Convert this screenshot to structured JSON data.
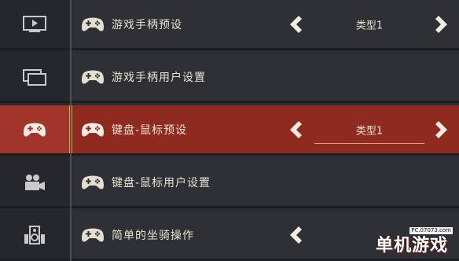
{
  "sidebar": {
    "icons": [
      "play-screen-icon",
      "windows-icon",
      "gamepad-icon",
      "video-camera-icon",
      "speaker-icon"
    ]
  },
  "rows": [
    {
      "label": "游戏手柄预设",
      "value": "类型1",
      "has_selector": true,
      "active": false
    },
    {
      "label": "游戏手柄用户设置",
      "has_selector": false,
      "active": false
    },
    {
      "label": "键盘-鼠标预设",
      "value": "类型1",
      "has_selector": true,
      "active": true
    },
    {
      "label": "键盘-鼠标用户设置",
      "has_selector": false,
      "active": false
    },
    {
      "label": "简单的坐骑操作",
      "has_selector": true,
      "active": false
    }
  ],
  "watermark": {
    "url": "PC.07073.com",
    "text": "单机游戏"
  },
  "colors": {
    "active_row": "#8f2a20",
    "accent": "#e2a436",
    "text": "#e8e2d2"
  }
}
